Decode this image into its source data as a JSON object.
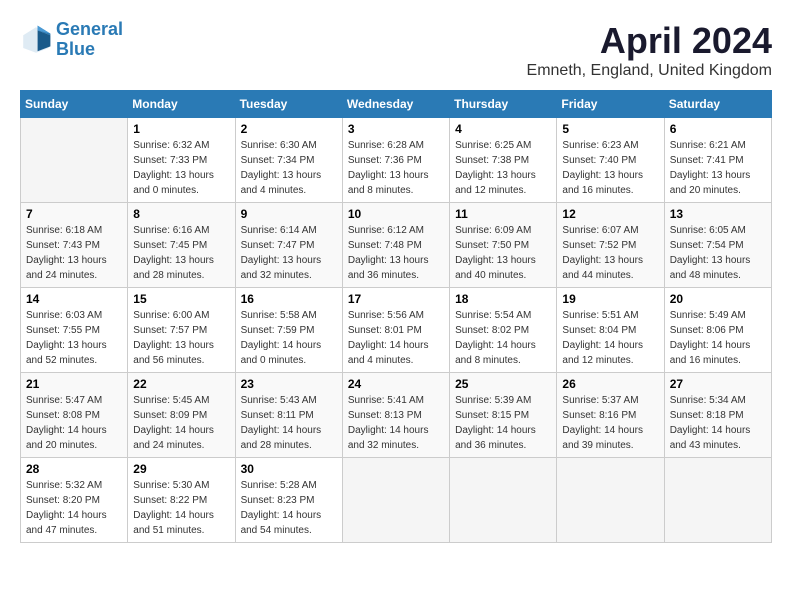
{
  "header": {
    "logo_line1": "General",
    "logo_line2": "Blue",
    "month_year": "April 2024",
    "location": "Emneth, England, United Kingdom"
  },
  "days_of_week": [
    "Sunday",
    "Monday",
    "Tuesday",
    "Wednesday",
    "Thursday",
    "Friday",
    "Saturday"
  ],
  "weeks": [
    [
      {
        "day": "",
        "info": ""
      },
      {
        "day": "1",
        "info": "Sunrise: 6:32 AM\nSunset: 7:33 PM\nDaylight: 13 hours\nand 0 minutes."
      },
      {
        "day": "2",
        "info": "Sunrise: 6:30 AM\nSunset: 7:34 PM\nDaylight: 13 hours\nand 4 minutes."
      },
      {
        "day": "3",
        "info": "Sunrise: 6:28 AM\nSunset: 7:36 PM\nDaylight: 13 hours\nand 8 minutes."
      },
      {
        "day": "4",
        "info": "Sunrise: 6:25 AM\nSunset: 7:38 PM\nDaylight: 13 hours\nand 12 minutes."
      },
      {
        "day": "5",
        "info": "Sunrise: 6:23 AM\nSunset: 7:40 PM\nDaylight: 13 hours\nand 16 minutes."
      },
      {
        "day": "6",
        "info": "Sunrise: 6:21 AM\nSunset: 7:41 PM\nDaylight: 13 hours\nand 20 minutes."
      }
    ],
    [
      {
        "day": "7",
        "info": "Sunrise: 6:18 AM\nSunset: 7:43 PM\nDaylight: 13 hours\nand 24 minutes."
      },
      {
        "day": "8",
        "info": "Sunrise: 6:16 AM\nSunset: 7:45 PM\nDaylight: 13 hours\nand 28 minutes."
      },
      {
        "day": "9",
        "info": "Sunrise: 6:14 AM\nSunset: 7:47 PM\nDaylight: 13 hours\nand 32 minutes."
      },
      {
        "day": "10",
        "info": "Sunrise: 6:12 AM\nSunset: 7:48 PM\nDaylight: 13 hours\nand 36 minutes."
      },
      {
        "day": "11",
        "info": "Sunrise: 6:09 AM\nSunset: 7:50 PM\nDaylight: 13 hours\nand 40 minutes."
      },
      {
        "day": "12",
        "info": "Sunrise: 6:07 AM\nSunset: 7:52 PM\nDaylight: 13 hours\nand 44 minutes."
      },
      {
        "day": "13",
        "info": "Sunrise: 6:05 AM\nSunset: 7:54 PM\nDaylight: 13 hours\nand 48 minutes."
      }
    ],
    [
      {
        "day": "14",
        "info": "Sunrise: 6:03 AM\nSunset: 7:55 PM\nDaylight: 13 hours\nand 52 minutes."
      },
      {
        "day": "15",
        "info": "Sunrise: 6:00 AM\nSunset: 7:57 PM\nDaylight: 13 hours\nand 56 minutes."
      },
      {
        "day": "16",
        "info": "Sunrise: 5:58 AM\nSunset: 7:59 PM\nDaylight: 14 hours\nand 0 minutes."
      },
      {
        "day": "17",
        "info": "Sunrise: 5:56 AM\nSunset: 8:01 PM\nDaylight: 14 hours\nand 4 minutes."
      },
      {
        "day": "18",
        "info": "Sunrise: 5:54 AM\nSunset: 8:02 PM\nDaylight: 14 hours\nand 8 minutes."
      },
      {
        "day": "19",
        "info": "Sunrise: 5:51 AM\nSunset: 8:04 PM\nDaylight: 14 hours\nand 12 minutes."
      },
      {
        "day": "20",
        "info": "Sunrise: 5:49 AM\nSunset: 8:06 PM\nDaylight: 14 hours\nand 16 minutes."
      }
    ],
    [
      {
        "day": "21",
        "info": "Sunrise: 5:47 AM\nSunset: 8:08 PM\nDaylight: 14 hours\nand 20 minutes."
      },
      {
        "day": "22",
        "info": "Sunrise: 5:45 AM\nSunset: 8:09 PM\nDaylight: 14 hours\nand 24 minutes."
      },
      {
        "day": "23",
        "info": "Sunrise: 5:43 AM\nSunset: 8:11 PM\nDaylight: 14 hours\nand 28 minutes."
      },
      {
        "day": "24",
        "info": "Sunrise: 5:41 AM\nSunset: 8:13 PM\nDaylight: 14 hours\nand 32 minutes."
      },
      {
        "day": "25",
        "info": "Sunrise: 5:39 AM\nSunset: 8:15 PM\nDaylight: 14 hours\nand 36 minutes."
      },
      {
        "day": "26",
        "info": "Sunrise: 5:37 AM\nSunset: 8:16 PM\nDaylight: 14 hours\nand 39 minutes."
      },
      {
        "day": "27",
        "info": "Sunrise: 5:34 AM\nSunset: 8:18 PM\nDaylight: 14 hours\nand 43 minutes."
      }
    ],
    [
      {
        "day": "28",
        "info": "Sunrise: 5:32 AM\nSunset: 8:20 PM\nDaylight: 14 hours\nand 47 minutes."
      },
      {
        "day": "29",
        "info": "Sunrise: 5:30 AM\nSunset: 8:22 PM\nDaylight: 14 hours\nand 51 minutes."
      },
      {
        "day": "30",
        "info": "Sunrise: 5:28 AM\nSunset: 8:23 PM\nDaylight: 14 hours\nand 54 minutes."
      },
      {
        "day": "",
        "info": ""
      },
      {
        "day": "",
        "info": ""
      },
      {
        "day": "",
        "info": ""
      },
      {
        "day": "",
        "info": ""
      }
    ]
  ]
}
